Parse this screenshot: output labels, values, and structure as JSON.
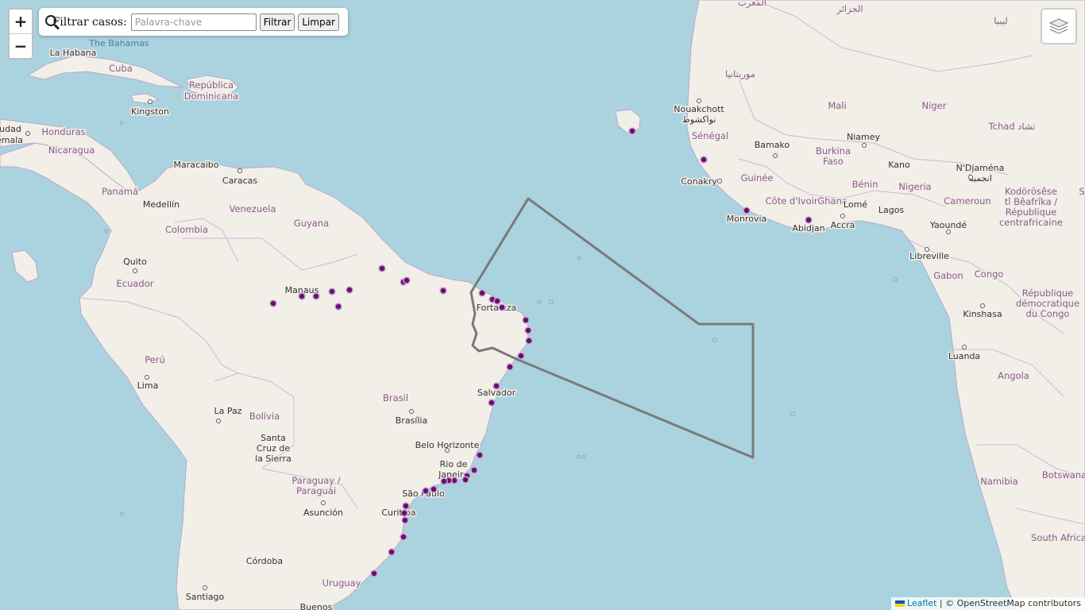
{
  "map": {
    "zoom_in_label": "+",
    "zoom_out_label": "−",
    "filter": {
      "icon": "search-icon",
      "title": "Filtrar casos:",
      "placeholder": "Palavra-chave",
      "value": "",
      "filter_button": "Filtrar",
      "clear_button": "Limpar"
    },
    "layers_icon": "layers-icon",
    "attribution": {
      "leaflet": "Leaflet",
      "separator": " | © ",
      "osm": "OpenStreetMap contributors"
    },
    "colors": {
      "ocean": "#aad3df",
      "land": "#f2efe9",
      "marker": "#6a0f6a",
      "zone_outline": "#7a7a7a"
    },
    "labels": {
      "bahamas": "The Bahamas",
      "la_habana": "La Habana",
      "cuba": "Cuba",
      "republica_dominicana": "República\nDominicana",
      "kingston": "Kingston",
      "honduras": "Honduras",
      "nicaragua": "Nicaragua",
      "udad": "udad",
      "emala": "emala",
      "maracaibo": "Maracaibo",
      "caracas": "Caracas",
      "panama": "Panamá",
      "medellin": "Medellín",
      "venezuela": "Venezuela",
      "guyana": "Guyana",
      "colombia": "Colombia",
      "quito": "Quito",
      "ecuador": "Ecuador",
      "manaus": "Manaus",
      "fortaleza": "Fortaleza",
      "peru": "Perú",
      "lima": "Lima",
      "brasil": "Brasil",
      "brasilia": "Brasília",
      "salvador": "Salvador",
      "la_paz": "La Paz",
      "bolivia": "Bolivia",
      "santa_cruz": "Santa\nCruz de\nla Sierra",
      "belo_horizonte": "Belo Horizonte",
      "rio": "Rio de\nJaneiro",
      "sao_paulo": "São Paulo",
      "paraguay": "Paraguay /\nParaguái",
      "asuncion": "Asunción",
      "curitiba": "Curitiba",
      "cordoba": "Córdoba",
      "uruguay": "Uruguay",
      "santiago": "Santiago",
      "buenos": "Buenos",
      "almaghrib": "المغرب",
      "aljazair": "الجزائر",
      "libya": "ليبيا",
      "mauritania": "موريتانيا",
      "nouakchott": "Nouakchott\nنواكشوط",
      "mali": "Mali",
      "niger": "Niger",
      "tchad": "Tchad تشاد",
      "senegal": "Sénégal",
      "bamako": "Bamako",
      "niamey": "Niamey",
      "burkina": "Burkina\nFaso",
      "kano": "Kano",
      "ndjamena": "N'Djaména\nانجمينا",
      "guinee": "Guinée",
      "conakry": "Conakry",
      "cote": "Côte d'Ivoire",
      "benin": "Bénin",
      "nigeria": "Nigeria",
      "ghana": "Ghana",
      "lome": "Lomé",
      "lagos": "Lagos",
      "cameroun": "Cameroun",
      "monrovia": "Monrovia",
      "abidjan": "Abidjan",
      "accra": "Accra",
      "yaounde": "Yaoundé",
      "kodorosese": "Kodörösêse\ntî Bêafrîka /\nRépublique\ncentrafricaine",
      "libreville": "Libreville",
      "gabon": "Gabon",
      "congo": "Congo",
      "rdc": "République\ndémocratique\ndu Congo",
      "kinshasa": "Kinshasa",
      "luanda": "Luanda",
      "angola": "Angola",
      "namibia": "Namibia",
      "botswana": "Botswana",
      "south_africa": "South Africa",
      "s_edge": "S"
    }
  }
}
